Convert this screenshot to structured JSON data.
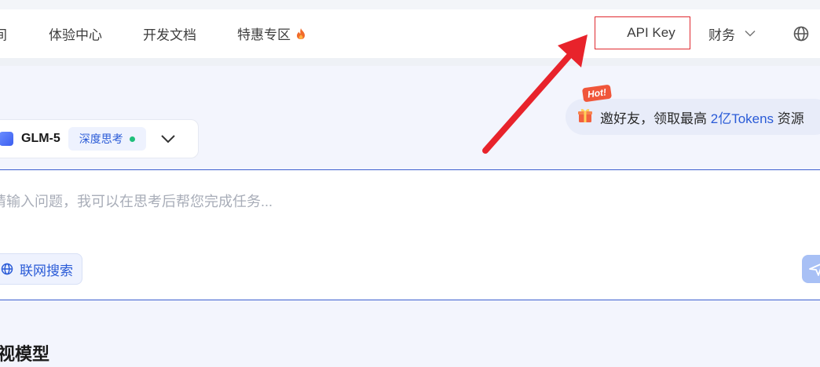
{
  "nav": {
    "items": [
      "间",
      "体验中心",
      "开发文档",
      "特惠专区"
    ],
    "api_key": "API Key",
    "finance": "财务"
  },
  "promo": {
    "badge": "Hot!",
    "text": "邀好友，领取最高 ",
    "highlight": "2亿Tokens",
    "suffix": " 资源"
  },
  "model": {
    "name": "GLM-5",
    "mode": "深度思考"
  },
  "input": {
    "placeholder": "请输入问题，我可以在思考后帮您完成任务...",
    "web_search": "联网搜索"
  },
  "section": {
    "title": "视模型"
  },
  "colors": {
    "accent": "#2a5bd7",
    "highlight_border": "#e0292f",
    "arrow": "#e8232b"
  }
}
